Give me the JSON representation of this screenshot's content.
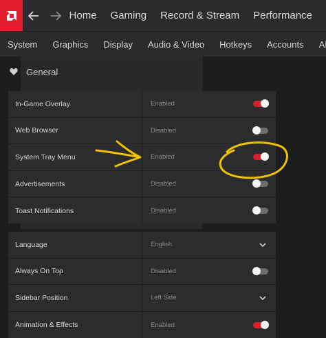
{
  "topbar": {
    "tabs": [
      "Home",
      "Gaming",
      "Record & Stream",
      "Performance"
    ]
  },
  "subbar": {
    "tabs": [
      "System",
      "Graphics",
      "Display",
      "Audio & Video",
      "Hotkeys",
      "Accounts",
      "AMD Link"
    ]
  },
  "section": {
    "title": "General"
  },
  "panel1": [
    {
      "label": "In-Game Overlay",
      "value": "Enabled",
      "toggle": true
    },
    {
      "label": "Web Browser",
      "value": "Disabled",
      "toggle": false
    },
    {
      "label": "System Tray Menu",
      "value": "Enabled",
      "toggle": true
    },
    {
      "label": "Advertisements",
      "value": "Disabled",
      "toggle": false
    },
    {
      "label": "Toast Notifications",
      "value": "Disabled",
      "toggle": false
    }
  ],
  "panel2": [
    {
      "label": "Language",
      "value": "English"
    },
    {
      "label": "Always On Top",
      "value": "Disabled",
      "toggle": false
    },
    {
      "label": "Sidebar Position",
      "value": "Left Side"
    },
    {
      "label": "Animation & Effects",
      "value": "Enabled",
      "toggle": true
    }
  ],
  "colors": {
    "accent": "#d8202f",
    "annotation": "#f2c200",
    "background": "#1c1d1f"
  },
  "icons": {
    "logo": "amd-logo-icon",
    "back": "arrow-left-icon",
    "forward": "arrow-right-icon",
    "section": "heart-icon",
    "dropdown": "chevron-down-icon"
  }
}
